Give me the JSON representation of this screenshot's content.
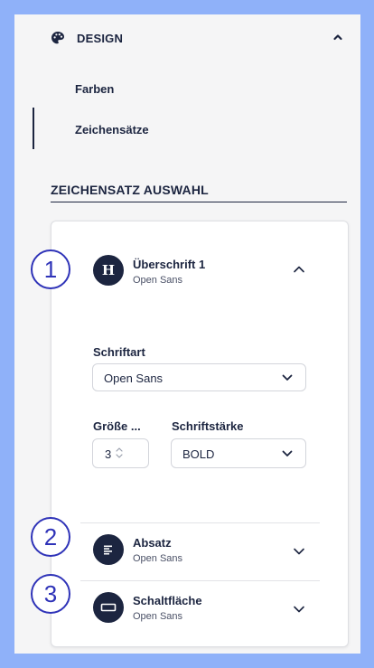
{
  "section": {
    "title": "DESIGN",
    "icon": "palette-icon",
    "expanded": true
  },
  "nav": {
    "items": [
      {
        "label": "Farben",
        "active": false
      },
      {
        "label": "Zeichensätze",
        "active": true
      }
    ]
  },
  "subheading": "ZEICHENSATZ AUSWAHL",
  "fonts": [
    {
      "title": "Überschrift 1",
      "font": "Open Sans",
      "icon": "heading-icon",
      "expanded": true
    },
    {
      "title": "Absatz",
      "font": "Open Sans",
      "icon": "paragraph-icon",
      "expanded": false
    },
    {
      "title": "Schaltfläche",
      "font": "Open Sans",
      "icon": "button-icon",
      "expanded": false
    }
  ],
  "editor": {
    "font_label": "Schriftart",
    "font_value": "Open Sans",
    "size_label": "Größe ...",
    "size_value": "3",
    "weight_label": "Schriftstärke",
    "weight_value": "BOLD"
  },
  "steps": [
    "1",
    "2",
    "3"
  ],
  "colors": {
    "background": "#8fb1f9",
    "panel": "#f5f5f6",
    "navy": "#1c2540",
    "step_accent": "#2f33b8"
  }
}
